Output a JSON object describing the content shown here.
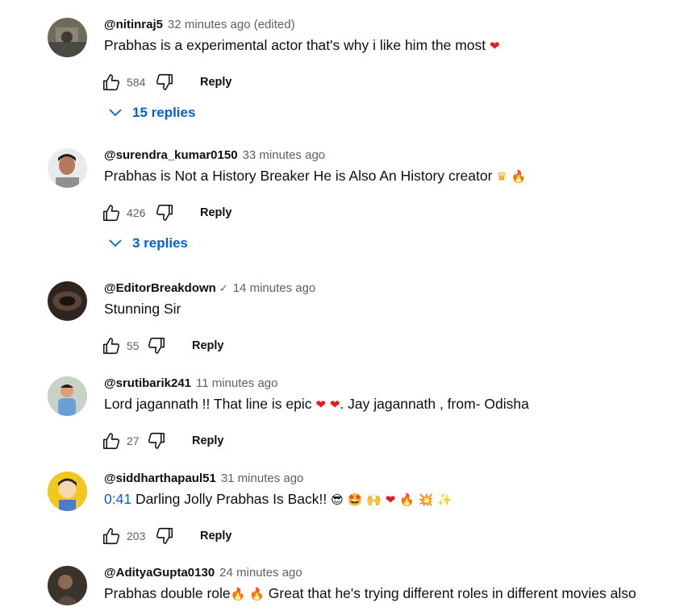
{
  "comments": [
    {
      "author": "@nitinraj5",
      "time": "32 minutes ago (edited)",
      "text": "Prabhas is a experimental actor that's why i like him the most",
      "emojis": [
        "❤"
      ],
      "likes": "584",
      "reply_label": "Reply",
      "replies": "15 replies"
    },
    {
      "author": "@surendra_kumar0150",
      "time": "33 minutes ago",
      "text": "Prabhas is Not a History Breaker He is Also An History creator",
      "emojis": [
        "♛",
        "🔥"
      ],
      "likes": "426",
      "reply_label": "Reply",
      "replies": "3 replies"
    },
    {
      "author": "@EditorBreakdown",
      "verified": "✓",
      "time": "14 minutes ago",
      "text": "Stunning Sir",
      "likes": "55",
      "reply_label": "Reply"
    },
    {
      "author": "@srutibarik241",
      "time": "11 minutes ago",
      "text_a": "Lord jagannath !! That line is epic",
      "emojis": [
        "❤",
        "❤"
      ],
      "text_b": ". Jay jagannath , from- Odisha",
      "likes": "27",
      "reply_label": "Reply"
    },
    {
      "author": "@siddharthapaul51",
      "time": "31 minutes ago",
      "timestamp": "0:41",
      "text": "Darling Jolly Prabhas Is Back!!",
      "emojis": [
        "😎",
        "🤩",
        "🙌",
        "❤",
        "🔥",
        "💥",
        "✨"
      ],
      "likes": "203",
      "reply_label": "Reply"
    },
    {
      "author": "@AdityaGupta0130",
      "time": "24 minutes ago",
      "text_a": "Prabhas double role",
      "emojis": [
        "🔥",
        "🔥"
      ],
      "text_b": "Great that he's trying different roles in different movies also"
    }
  ],
  "colors": {
    "link": "#065fd4",
    "secondary": "#606060",
    "primary": "#0f0f0f"
  },
  "icons": {
    "like": "thumbs-up-icon",
    "dislike": "thumbs-down-icon",
    "expand": "chevron-down-icon"
  }
}
